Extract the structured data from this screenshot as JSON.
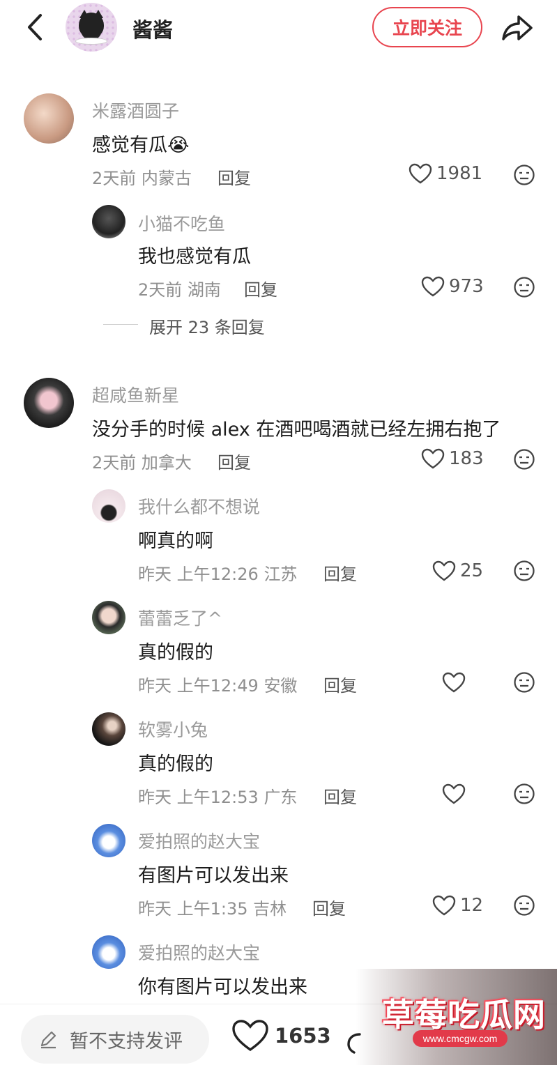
{
  "header": {
    "username": "酱酱",
    "follow_label": "立即关注"
  },
  "comments": [
    {
      "name": "米露酒圆子",
      "text": "感觉有瓜",
      "emoji": "😭",
      "time": "2天前",
      "location": "内蒙古",
      "reply_label": "回复",
      "likes": "1981",
      "replies": [
        {
          "name": "小猫不吃鱼",
          "text": "我也感觉有瓜",
          "time": "2天前",
          "location": "湖南",
          "reply_label": "回复",
          "likes": "973"
        }
      ],
      "expand_label": "展开 23 条回复"
    },
    {
      "name": "超咸鱼新星",
      "text": "没分手的时候 alex 在酒吧喝酒就已经左拥右抱了",
      "time": "2天前",
      "location": "加拿大",
      "reply_label": "回复",
      "likes": "183",
      "replies": [
        {
          "name": "我什么都不想说",
          "text": "啊真的啊",
          "time": "昨天 上午12:26",
          "location": "江苏",
          "reply_label": "回复",
          "likes": "25"
        },
        {
          "name": "蕾蕾乏了^",
          "text": "真的假的",
          "time": "昨天 上午12:49",
          "location": "安徽",
          "reply_label": "回复",
          "likes": ""
        },
        {
          "name": "软雾小兔",
          "text": "真的假的",
          "time": "昨天 上午12:53",
          "location": "广东",
          "reply_label": "回复",
          "likes": ""
        },
        {
          "name": "爱拍照的赵大宝",
          "text": "有图片可以发出来",
          "time": "昨天 上午1:35",
          "location": "吉林",
          "reply_label": "回复",
          "likes": "12"
        },
        {
          "name": "爱拍照的赵大宝",
          "text": "你有图片可以发出来"
        }
      ]
    }
  ],
  "bottom_bar": {
    "input_placeholder": "暂不支持发评",
    "like_count": "1653"
  },
  "watermark": {
    "title": "草莓吃瓜网",
    "url": "www.cmcgw.com"
  },
  "colors": {
    "accent": "#e8454f",
    "muted_text": "#9a9a9a"
  },
  "icons": [
    "back-icon",
    "share-icon",
    "heart-icon",
    "dislike-face-icon",
    "pencil-icon"
  ]
}
